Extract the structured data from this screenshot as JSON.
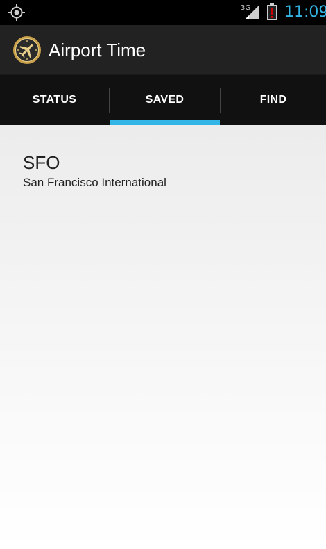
{
  "status_bar": {
    "network_type": "3G",
    "time": "11:09",
    "icons": [
      "gps-icon",
      "signal-icon",
      "battery-alert-icon"
    ]
  },
  "action_bar": {
    "title": "Airport Time",
    "icon": "airport-clock-icon"
  },
  "tabs": [
    {
      "label": "STATUS",
      "selected": false
    },
    {
      "label": "SAVED",
      "selected": true
    },
    {
      "label": "FIND",
      "selected": false
    }
  ],
  "saved_list": [
    {
      "code": "SFO",
      "name": "San Francisco International"
    }
  ],
  "colors": {
    "accent": "#33b5e5",
    "action_bar": "#222222",
    "tab_bar": "#111111",
    "battery_alert": "#cc0000"
  }
}
